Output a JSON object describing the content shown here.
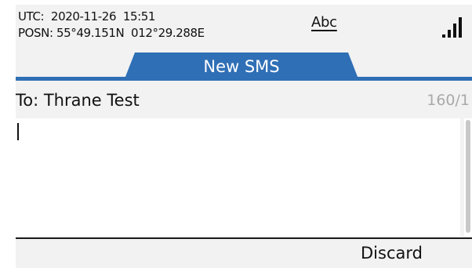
{
  "status_bar": {
    "utc_line": "UTC:  2020-11-26  15:51",
    "posn_line": "POSN: 55°49.151N  012°29.288E",
    "input_mode": "Abc",
    "signal_icon": "signal-strength-icon"
  },
  "tab": {
    "label": "New SMS"
  },
  "compose": {
    "recipient": "To: Thrane Test",
    "char_counter": "160/1",
    "message_text": ""
  },
  "softkeys": {
    "discard_label": "Discard"
  },
  "colors": {
    "accent": "#2f6fb6",
    "background": "#f2f2f2",
    "counter_text": "#a9a9a9"
  }
}
